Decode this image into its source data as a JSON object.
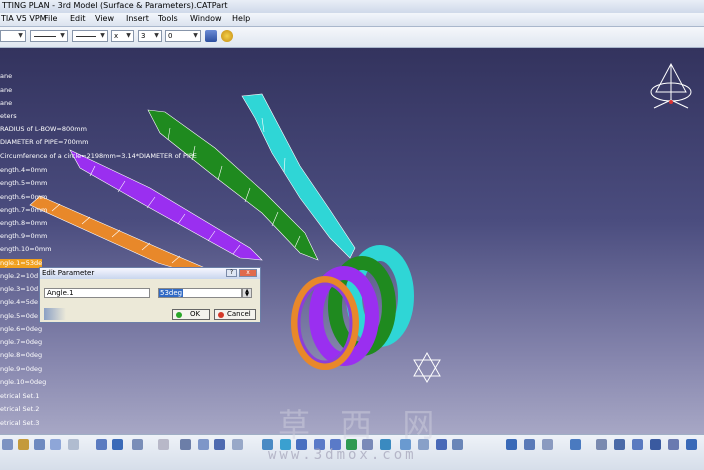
{
  "window": {
    "title": "TTING PLAN - 3rd Model (Surface & Parameters).CATPart"
  },
  "menu": {
    "items": [
      "TIA V5 VPM",
      "File",
      "Edit",
      "View",
      "Insert",
      "Tools",
      "Window",
      "Help"
    ]
  },
  "toolbar": {
    "x_label": "x",
    "layer_value": "3",
    "filter_value": "0"
  },
  "tree": {
    "items": [
      "ane",
      "ane",
      "ane",
      "eters",
      "RADIUS of L-BOW=800mm",
      "DIAMETER of PIPE=700mm",
      "Circumference of a circle=2198mm=3.14*DIAMETER of PIPE",
      "ength.4=0mm",
      "ength.5=0mm",
      "ength.6=0mm",
      "ength.7=0mm",
      "ength.8=0mm",
      "ength.9=0mm",
      "ength.10=0mm",
      "ngle.1=53de",
      "ngle.2=10d",
      "ngle.3=10d",
      "ngle.4=5de",
      "ngle.5=0de",
      "ngle.6=0deg",
      "ngle.7=0deg",
      "ngle.8=0deg",
      "ngle.9=0deg",
      "ngle.10=0deg",
      "etrical Set.1",
      "etrical Set.2",
      "etrical Set.3"
    ]
  },
  "dialog": {
    "title": "Edit Parameter",
    "help_label": "?",
    "close_label": "x",
    "param_name": "Angle.1",
    "param_value": "53deg",
    "ok_label": "OK",
    "cancel_label": "Cancel"
  },
  "watermark": {
    "chars": "草 西 网",
    "url": "www.3dmox.com"
  },
  "colors": {
    "viewport_top": "#33335e",
    "viewport_bottom": "#a7a7c5",
    "strip_orange": "#e8882a",
    "strip_purple": "#9a2ff0",
    "strip_green": "#1f8a1f",
    "strip_cyan": "#2fd6d6",
    "tree_highlight": "#f0a01e"
  },
  "icons": [
    "compass-icon",
    "axis-icon",
    "fit-all-icon",
    "pan-icon",
    "rotate-icon",
    "zoom-in-icon",
    "zoom-out-icon",
    "normal-view-icon",
    "hide-show-icon",
    "sketcher-icon",
    "formula-icon",
    "measure-icon"
  ]
}
